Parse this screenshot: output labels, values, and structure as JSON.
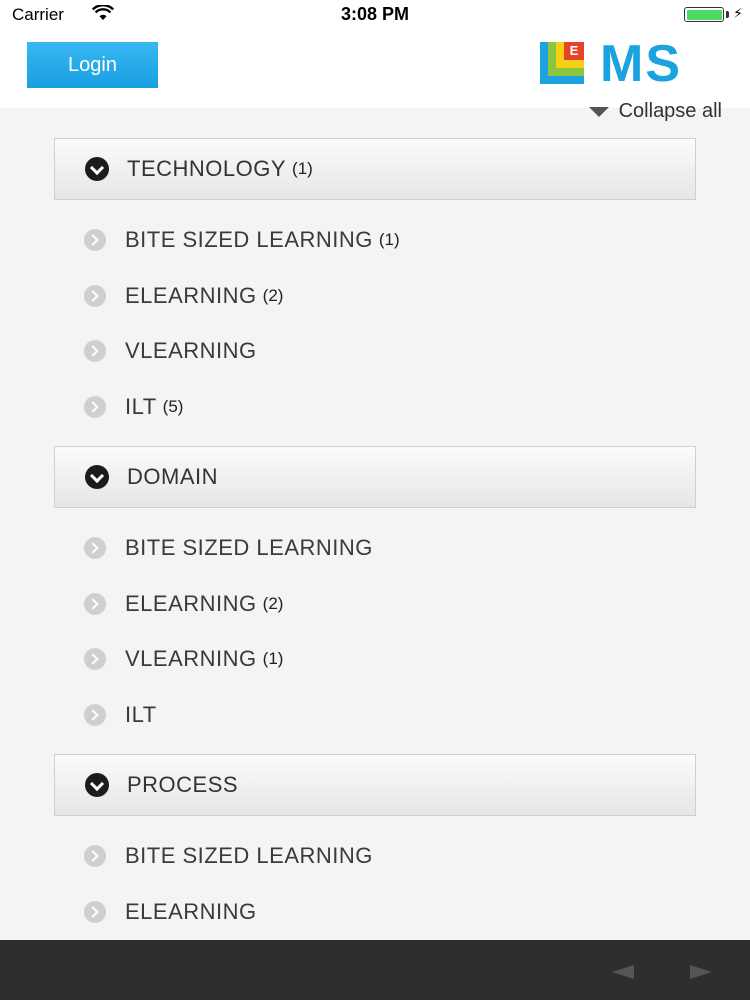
{
  "status": {
    "carrier": "Carrier",
    "time": "3:08 PM",
    "battery_level": 1.0
  },
  "header": {
    "login_label": "Login",
    "logo_text": "MS",
    "logo_mark": "E"
  },
  "collapse_all_label": "Collapse all",
  "colors": {
    "accent": "#1ba3e0",
    "bottom_bar": "#2e2e2e",
    "background": "#f4f3f5"
  },
  "sections": [
    {
      "title": "TECHNOLOGY",
      "count": "(1)",
      "items": [
        {
          "label": "BITE SIZED LEARNING",
          "count": "(1)"
        },
        {
          "label": "ELEARNING",
          "count": "(2)"
        },
        {
          "label": "VLEARNING",
          "count": ""
        },
        {
          "label": "ILT",
          "count": "(5)"
        }
      ]
    },
    {
      "title": "DOMAIN",
      "count": "",
      "items": [
        {
          "label": "BITE SIZED LEARNING",
          "count": ""
        },
        {
          "label": "ELEARNING",
          "count": "(2)"
        },
        {
          "label": "VLEARNING",
          "count": "(1)"
        },
        {
          "label": "ILT",
          "count": ""
        }
      ]
    },
    {
      "title": "PROCESS",
      "count": "",
      "items": [
        {
          "label": "BITE SIZED LEARNING",
          "count": ""
        },
        {
          "label": "ELEARNING",
          "count": ""
        }
      ]
    }
  ],
  "icons": {
    "section": "chevron-down-circle-icon",
    "item": "chevron-right-circle-icon",
    "nav_back": "back-arrow-icon",
    "nav_forward": "forward-arrow-icon"
  }
}
